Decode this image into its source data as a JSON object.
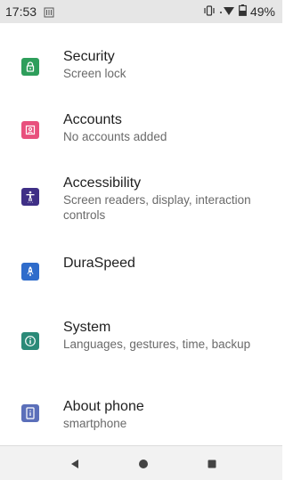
{
  "status_bar": {
    "time": "17:53",
    "battery": "49%",
    "icons": [
      "sim-card-icon",
      "vibrate-icon",
      "wifi-icon",
      "battery-icon"
    ]
  },
  "settings": [
    {
      "id": "security",
      "title": "Security",
      "subtitle": "Screen lock",
      "icon": "lock-icon",
      "color": "#2e9e5b"
    },
    {
      "id": "accounts",
      "title": "Accounts",
      "subtitle": "No accounts added",
      "icon": "account-box-icon",
      "color": "#e8507d"
    },
    {
      "id": "accessibility",
      "title": "Accessibility",
      "subtitle": "Screen readers, display, interaction controls",
      "icon": "accessibility-icon",
      "color": "#3f2f86"
    },
    {
      "id": "duraspeed",
      "title": "DuraSpeed",
      "subtitle": "",
      "icon": "rocket-icon",
      "color": "#2f6ccb"
    },
    {
      "id": "system",
      "title": "System",
      "subtitle": "Languages, gestures, time, backup",
      "icon": "info-icon",
      "color": "#2b8a78"
    },
    {
      "id": "about-phone",
      "title": "About phone",
      "subtitle": "smartphone",
      "icon": "phone-info-icon",
      "color": "#5b6fba"
    }
  ],
  "nav_bar": {
    "buttons": [
      "back-icon",
      "home-icon",
      "recents-icon"
    ]
  }
}
